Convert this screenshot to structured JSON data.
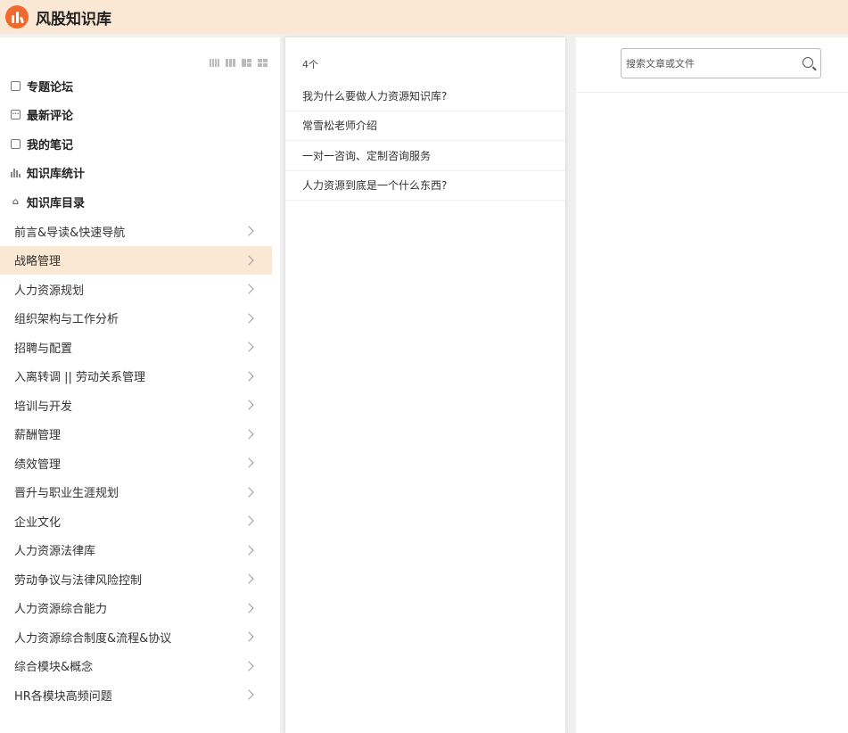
{
  "app": {
    "title": "风股知识库"
  },
  "quick_links": [
    {
      "label": "专题论坛",
      "icon": "forum-icon"
    },
    {
      "label": "最新评论",
      "icon": "comment-icon"
    },
    {
      "label": "我的笔记",
      "icon": "note-icon"
    },
    {
      "label": "知识库统计",
      "icon": "stats-icon"
    },
    {
      "label": "知识库目录",
      "icon": "home-icon"
    }
  ],
  "nav": {
    "active_index": 1,
    "items": [
      {
        "label": "前言&导读&快速导航"
      },
      {
        "label": "战略管理"
      },
      {
        "label": "人力资源规划"
      },
      {
        "label": "组织架构与工作分析"
      },
      {
        "label": "招聘与配置"
      },
      {
        "label": "入离转调 || 劳动关系管理"
      },
      {
        "label": "培训与开发"
      },
      {
        "label": "薪酬管理"
      },
      {
        "label": "绩效管理"
      },
      {
        "label": "晋升与职业生涯规划"
      },
      {
        "label": "企业文化"
      },
      {
        "label": "人力资源法律库"
      },
      {
        "label": "劳动争议与法律风险控制"
      },
      {
        "label": "人力资源综合能力"
      },
      {
        "label": "人力资源综合制度&流程&协议"
      },
      {
        "label": "综合模块&概念"
      },
      {
        "label": "HR各模块高频问题"
      }
    ]
  },
  "articles": {
    "count_label": "4个",
    "items": [
      {
        "title": "我为什么要做人力资源知识库?"
      },
      {
        "title": "常雪松老师介绍"
      },
      {
        "title": "一对一咨询、定制咨询服务"
      },
      {
        "title": "人力资源到底是一个什么东西?"
      }
    ]
  },
  "search": {
    "placeholder": "搜索文章或文件",
    "value": ""
  },
  "colors": {
    "accent": "#ef6a2e",
    "header_bg": "#fbe8d4",
    "active_bg": "#fbe8d4"
  }
}
